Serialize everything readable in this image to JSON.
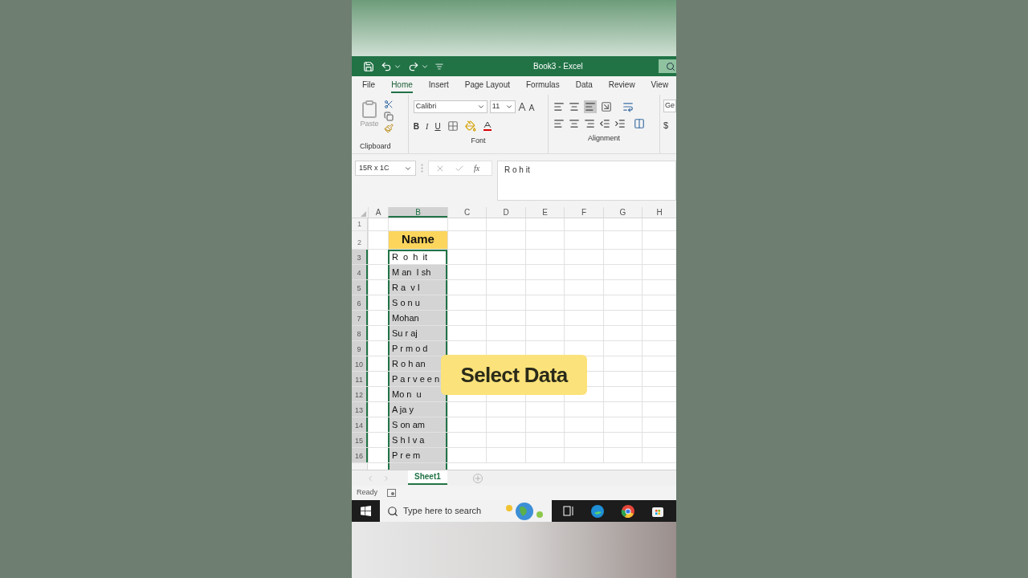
{
  "window": {
    "title": "Book3 - Excel"
  },
  "ribbon_tabs": [
    {
      "label": "File",
      "selected": false
    },
    {
      "label": "Home",
      "selected": true
    },
    {
      "label": "Insert",
      "selected": false
    },
    {
      "label": "Page Layout",
      "selected": false
    },
    {
      "label": "Formulas",
      "selected": false
    },
    {
      "label": "Data",
      "selected": false
    },
    {
      "label": "Review",
      "selected": false
    },
    {
      "label": "View",
      "selected": false
    }
  ],
  "ribbon": {
    "paste_label": "Paste",
    "font_name": "Calibri",
    "font_size": "11",
    "bold": "B",
    "italic": "I",
    "underline": "U",
    "number_format": "Ge",
    "currency": "$",
    "groups": [
      "Clipboard",
      "Font",
      "Alignment"
    ]
  },
  "formula_bar": {
    "name_box": "15R x 1C",
    "fx": "fx",
    "value": "R o h it"
  },
  "sheet": {
    "columns": [
      {
        "label": "A",
        "selected": false
      },
      {
        "label": "B",
        "selected": true
      },
      {
        "label": "C",
        "selected": false
      },
      {
        "label": "D",
        "selected": false
      },
      {
        "label": "E",
        "selected": false
      },
      {
        "label": "F",
        "selected": false
      },
      {
        "label": "G",
        "selected": false
      },
      {
        "label": "H",
        "selected": false
      }
    ],
    "rows": [
      {
        "number": "1",
        "kind": "blank",
        "selected": false,
        "active": false
      },
      {
        "number": "2",
        "kind": "header",
        "value": "Name",
        "selected": false,
        "active": false
      },
      {
        "number": "3",
        "kind": "data",
        "value": "R  o  h  it",
        "selected": true,
        "active": true
      },
      {
        "number": "4",
        "kind": "data",
        "value": "M an  I sh",
        "selected": true,
        "active": false
      },
      {
        "number": "5",
        "kind": "data",
        "value": "R a  v I",
        "selected": true,
        "active": false
      },
      {
        "number": "6",
        "kind": "data",
        "value": "S o n u",
        "selected": true,
        "active": false
      },
      {
        "number": "7",
        "kind": "data",
        "value": "Mohan",
        "selected": true,
        "active": false
      },
      {
        "number": "8",
        "kind": "data",
        "value": "Su r aj",
        "selected": true,
        "active": false
      },
      {
        "number": "9",
        "kind": "data",
        "value": "P r m o d",
        "selected": true,
        "active": false
      },
      {
        "number": "10",
        "kind": "data",
        "value": "R o h an",
        "selected": true,
        "active": false
      },
      {
        "number": "11",
        "kind": "data",
        "value": "P a r v e e n",
        "selected": true,
        "active": false
      },
      {
        "number": "12",
        "kind": "data",
        "value": "Mo n  u",
        "selected": true,
        "active": false
      },
      {
        "number": "13",
        "kind": "data",
        "value": "A ja y",
        "selected": true,
        "active": false
      },
      {
        "number": "14",
        "kind": "data",
        "value": "S on am",
        "selected": true,
        "active": false
      },
      {
        "number": "15",
        "kind": "data",
        "value": "S h I v a",
        "selected": true,
        "active": false
      },
      {
        "number": "16",
        "kind": "data",
        "value": "P r e m",
        "selected": true,
        "active": false
      }
    ]
  },
  "sheet_tabs": [
    {
      "label": "Sheet1",
      "selected": true
    }
  ],
  "status_bar": {
    "text": "Ready"
  },
  "taskbar": {
    "search_placeholder": "Type here to search"
  },
  "caption": "Select Data"
}
